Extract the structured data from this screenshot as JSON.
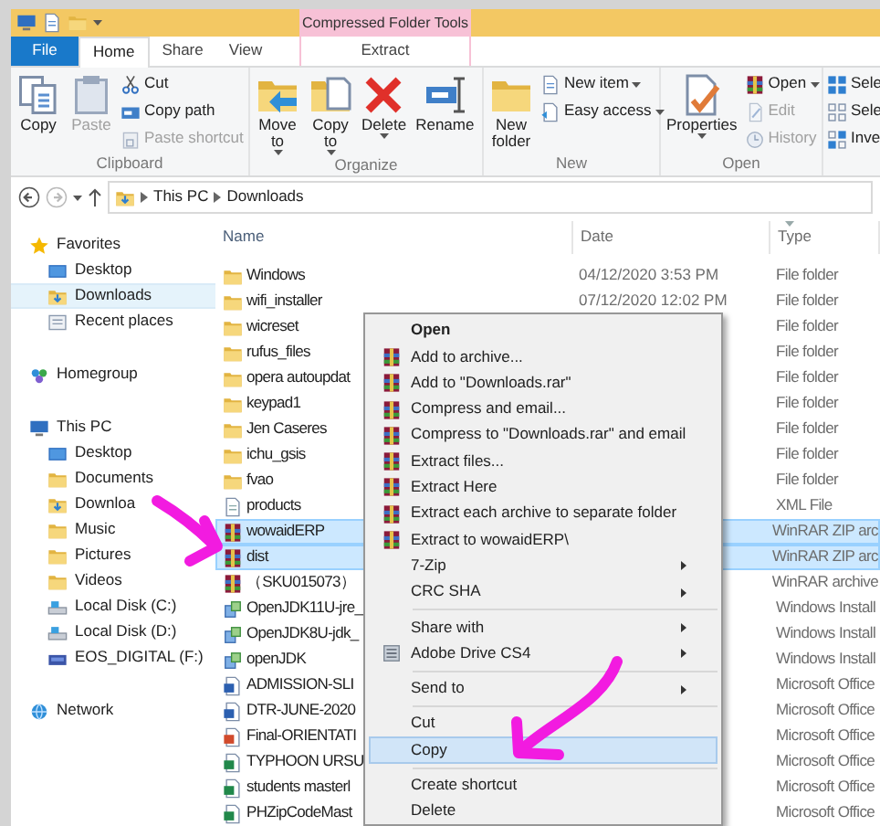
{
  "title_bar": {
    "context_tab": "Compressed Folder Tools"
  },
  "ribbon_tabs": [
    {
      "label": "File",
      "kind": "file",
      "selected": false
    },
    {
      "label": "Home",
      "kind": "tab",
      "selected": true
    },
    {
      "label": "Share",
      "kind": "tab",
      "selected": false
    },
    {
      "label": "View",
      "kind": "tab",
      "selected": false
    },
    {
      "label": "Extract",
      "kind": "context",
      "selected": false
    }
  ],
  "ribbon_groups": [
    {
      "label": "Clipboard",
      "large": [
        {
          "label": "Copy",
          "kind": "copy",
          "dropdown": false,
          "disabled": false
        },
        {
          "label": "Paste",
          "kind": "paste",
          "dropdown": false,
          "disabled": true
        }
      ],
      "small": [
        {
          "label": "Cut",
          "kind": "cut",
          "dropdown": false,
          "disabled": false
        },
        {
          "label": "Copy path",
          "kind": "copypath",
          "dropdown": false,
          "disabled": false
        },
        {
          "label": "Paste shortcut",
          "kind": "pasteshortcut",
          "dropdown": false,
          "disabled": true
        }
      ]
    },
    {
      "label": "Organize",
      "large": [
        {
          "label": "Move to",
          "kind": "move",
          "dropdown": true,
          "disabled": false
        },
        {
          "label": "Copy to",
          "kind": "copyto",
          "dropdown": true,
          "disabled": false
        },
        {
          "label": "Delete",
          "kind": "delete",
          "dropdown": true,
          "disabled": false
        },
        {
          "label": "Rename",
          "kind": "rename",
          "dropdown": false,
          "disabled": false
        }
      ]
    },
    {
      "label": "New",
      "large": [
        {
          "label": "New folder",
          "kind": "newfolder",
          "dropdown": false,
          "disabled": false
        }
      ],
      "small": [
        {
          "label": "New item",
          "kind": "newitem",
          "dropdown": true,
          "disabled": false
        },
        {
          "label": "Easy access",
          "kind": "easyaccess",
          "dropdown": true,
          "disabled": false
        }
      ]
    },
    {
      "label": "Open",
      "large": [
        {
          "label": "Properties",
          "kind": "properties",
          "dropdown": true,
          "disabled": false
        }
      ],
      "small": [
        {
          "label": "Open",
          "kind": "winrar",
          "dropdown": true,
          "disabled": false
        },
        {
          "label": "Edit",
          "kind": "edit",
          "dropdown": false,
          "disabled": true
        },
        {
          "label": "History",
          "kind": "history",
          "dropdown": false,
          "disabled": true
        }
      ]
    },
    {
      "small": [
        {
          "label": "Sele",
          "kind": "selectall",
          "disabled": false
        },
        {
          "label": "Sele",
          "kind": "selectnone",
          "disabled": false
        },
        {
          "label": "Inve",
          "kind": "invert",
          "disabled": false
        }
      ]
    }
  ],
  "address": {
    "path": [
      "This PC",
      "Downloads"
    ]
  },
  "sidebar": [
    {
      "label": "Favorites",
      "kind": "star",
      "selected": false,
      "children": [
        {
          "label": "Desktop",
          "kind": "desktop",
          "selected": false
        },
        {
          "label": "Downloads",
          "kind": "download",
          "selected": true
        },
        {
          "label": "Recent places",
          "kind": "recent",
          "selected": false
        }
      ]
    },
    {
      "label": "Homegroup",
      "kind": "homegroup",
      "selected": false
    },
    {
      "label": "This PC",
      "kind": "pc",
      "selected": false,
      "children": [
        {
          "label": "Desktop",
          "kind": "desktop",
          "selected": false
        },
        {
          "label": "Documents",
          "kind": "folder",
          "selected": false
        },
        {
          "label": "Downloa",
          "kind": "download",
          "selected": false
        },
        {
          "label": "Music",
          "kind": "folder",
          "selected": false
        },
        {
          "label": "Pictures",
          "kind": "folder",
          "selected": false
        },
        {
          "label": "Videos",
          "kind": "folder",
          "selected": false
        },
        {
          "label": "Local Disk (C:)",
          "kind": "disk",
          "selected": false
        },
        {
          "label": "Local Disk (D:)",
          "kind": "disk",
          "selected": false
        },
        {
          "label": "EOS_DIGITAL (F:)",
          "kind": "usb",
          "selected": false
        }
      ]
    },
    {
      "label": "Network",
      "kind": "network",
      "selected": false
    }
  ],
  "file_list": {
    "columns": [
      {
        "label": "Name",
        "sorted": false
      },
      {
        "label": "Date",
        "sorted": false
      },
      {
        "label": "Type",
        "sorted": true
      }
    ],
    "rows": [
      {
        "name": "Windows",
        "date": "04/12/2020 3:53 PM",
        "type": "File folder",
        "kind": "folder",
        "selected": false
      },
      {
        "name": "wifi_installer",
        "date": "07/12/2020 12:02 PM",
        "type": "File folder",
        "kind": "folder",
        "selected": false
      },
      {
        "name": "wicreset",
        "type": "File folder",
        "kind": "folder",
        "selected": false
      },
      {
        "name": "rufus_files",
        "type": "File folder",
        "kind": "folder",
        "selected": false
      },
      {
        "name": "opera autoupdat",
        "type": "File folder",
        "kind": "folder",
        "selected": false
      },
      {
        "name": "keypad1",
        "type": "File folder",
        "kind": "folder",
        "selected": false
      },
      {
        "name": "Jen Caseres",
        "type": "File folder",
        "kind": "folder",
        "selected": false
      },
      {
        "name": "ichu_gsis",
        "type": "File folder",
        "kind": "folder",
        "selected": false
      },
      {
        "name": "fvao",
        "type": "File folder",
        "kind": "folder",
        "selected": false
      },
      {
        "name": "products",
        "type": "XML File",
        "kind": "xml",
        "selected": false
      },
      {
        "name": "wowaidERP",
        "type": "WinRAR ZIP arc",
        "kind": "winrar",
        "selected": true
      },
      {
        "name": "dist",
        "type": "WinRAR ZIP arc",
        "kind": "winrar",
        "selected": true
      },
      {
        "name": "（SKU015073）",
        "type": "WinRAR archive",
        "kind": "winrar",
        "selected": false
      },
      {
        "name": "OpenJDK11U-jre_",
        "type": "Windows Install",
        "kind": "msi",
        "selected": false
      },
      {
        "name": "OpenJDK8U-jdk_",
        "type": "Windows Install",
        "kind": "msi",
        "selected": false
      },
      {
        "name": "openJDK",
        "type": "Windows Install",
        "kind": "msi",
        "selected": false
      },
      {
        "name": "ADMISSION-SLI",
        "type": "Microsoft Office",
        "kind": "word",
        "selected": false
      },
      {
        "name": "DTR-JUNE-2020",
        "type": "Microsoft Office",
        "kind": "word",
        "selected": false
      },
      {
        "name": "Final-ORIENTATI",
        "type": "Microsoft Office",
        "kind": "ppt",
        "selected": false
      },
      {
        "name": "TYPHOON URSU",
        "type": "Microsoft Office",
        "kind": "excel",
        "selected": false
      },
      {
        "name": "students masterl",
        "type": "Microsoft Office",
        "kind": "excel",
        "selected": false
      },
      {
        "name": "PHZipCodeMast",
        "type": "Microsoft Office",
        "kind": "excel",
        "selected": false
      }
    ]
  },
  "context_menu": [
    {
      "label": "Open",
      "kind": "plain",
      "bold": true,
      "submenu": false,
      "selected": false
    },
    {
      "label": "Add to archive...",
      "kind": "archive",
      "bold": false,
      "submenu": false,
      "selected": false
    },
    {
      "label": "Add to \"Downloads.rar\"",
      "kind": "archive",
      "bold": false,
      "submenu": false,
      "selected": false
    },
    {
      "label": "Compress and email...",
      "kind": "archive",
      "bold": false,
      "submenu": false,
      "selected": false
    },
    {
      "label": "Compress to \"Downloads.rar\" and email",
      "kind": "archive",
      "bold": false,
      "submenu": false,
      "selected": false
    },
    {
      "label": "Extract files...",
      "kind": "archive",
      "bold": false,
      "submenu": false,
      "selected": false
    },
    {
      "label": "Extract Here",
      "kind": "archive",
      "bold": false,
      "submenu": false,
      "selected": false
    },
    {
      "label": "Extract each archive to separate folder",
      "kind": "archive",
      "bold": false,
      "submenu": false,
      "selected": false
    },
    {
      "label": "Extract to wowaidERP\\",
      "kind": "archive",
      "bold": false,
      "submenu": false,
      "selected": false
    },
    {
      "label": "7-Zip",
      "kind": "plain",
      "bold": false,
      "submenu": true,
      "selected": false
    },
    {
      "label": "CRC SHA",
      "kind": "plain",
      "bold": false,
      "submenu": true,
      "selected": false
    },
    {
      "kind": "separator"
    },
    {
      "label": "Share with",
      "kind": "plain",
      "bold": false,
      "submenu": true,
      "selected": false
    },
    {
      "label": "Adobe Drive CS4",
      "kind": "drive",
      "bold": false,
      "submenu": true,
      "selected": false
    },
    {
      "kind": "separator"
    },
    {
      "label": "Send to",
      "kind": "plain",
      "bold": false,
      "submenu": true,
      "selected": false
    },
    {
      "kind": "separator"
    },
    {
      "label": "Cut",
      "kind": "plain",
      "bold": false,
      "submenu": false,
      "selected": false
    },
    {
      "label": "Copy",
      "kind": "plain",
      "bold": false,
      "submenu": false,
      "selected": true
    },
    {
      "kind": "separator"
    },
    {
      "label": "Create shortcut",
      "kind": "plain",
      "bold": false,
      "submenu": false,
      "selected": false
    },
    {
      "label": "Delete",
      "kind": "plain",
      "bold": false,
      "submenu": false,
      "selected": false
    }
  ]
}
